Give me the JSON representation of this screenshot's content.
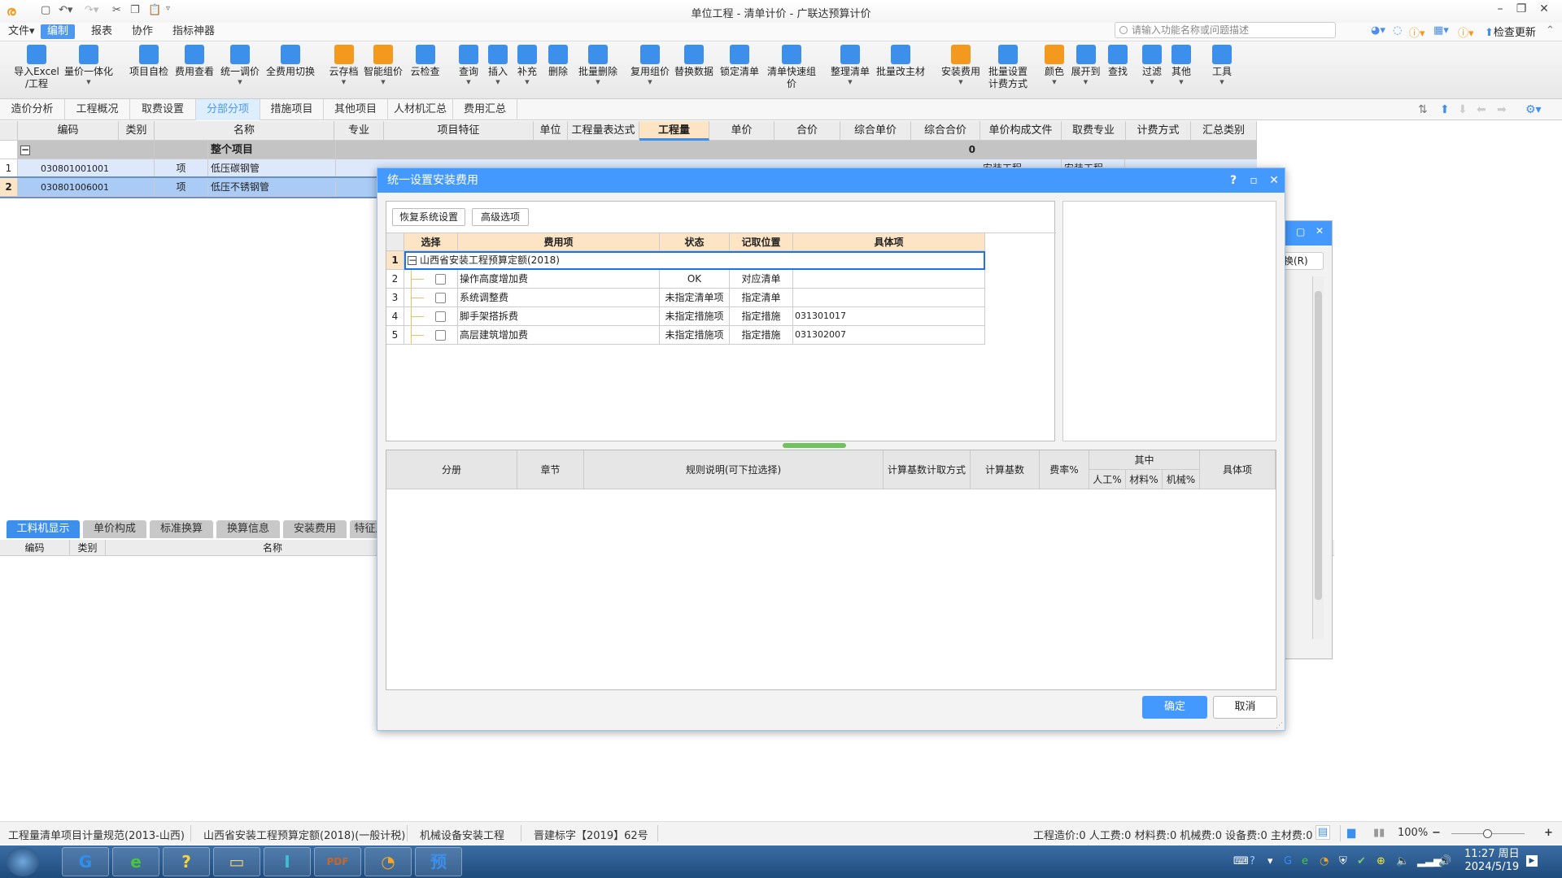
{
  "window": {
    "title": "单位工程 - 清单计价 - 广联达预算计价",
    "quick_access": [
      "save-icon",
      "undo-icon",
      "redo-icon",
      "cut-icon",
      "copy-icon",
      "paste-icon",
      "customize-icon"
    ]
  },
  "menu": {
    "items": [
      "文件▾",
      "编制",
      "报表",
      "协作",
      "指标神器"
    ],
    "active": "编制"
  },
  "search": {
    "placeholder": "请输入功能名称或问题描述"
  },
  "top_right": {
    "check_update": "检查更新"
  },
  "ribbon": {
    "buttons": [
      {
        "label": "导入Excel",
        "label2": "/工程",
        "icon": "import-excel-icon"
      },
      {
        "label": "量价一体化",
        "icon": "quantity-price-icon",
        "dropdown": true
      },
      {
        "label": "项目自检",
        "icon": "self-check-icon"
      },
      {
        "label": "费用查看",
        "icon": "fee-view-icon"
      },
      {
        "label": "统一调价",
        "icon": "adjust-price-icon",
        "dropdown": true
      },
      {
        "label": "全费用切换",
        "icon": "full-fee-switch-icon"
      },
      {
        "label": "云存档",
        "icon": "cloud-save-icon",
        "dropdown": true
      },
      {
        "label": "智能组价",
        "icon": "smart-pricing-icon",
        "dropdown": true
      },
      {
        "label": "云检查",
        "icon": "cloud-check-icon"
      },
      {
        "label": "查询",
        "icon": "query-icon",
        "dropdown": true
      },
      {
        "label": "插入",
        "icon": "insert-icon",
        "dropdown": true
      },
      {
        "label": "补充",
        "icon": "supplement-icon",
        "dropdown": true
      },
      {
        "label": "删除",
        "icon": "delete-icon"
      },
      {
        "label": "批量删除",
        "icon": "batch-delete-icon",
        "dropdown": true
      },
      {
        "label": "复用组价",
        "icon": "reuse-pricing-icon",
        "dropdown": true
      },
      {
        "label": "替换数据",
        "icon": "replace-data-icon"
      },
      {
        "label": "锁定清单",
        "icon": "lock-list-icon"
      },
      {
        "label": "清单快速组价",
        "icon": "quick-pricing-icon"
      },
      {
        "label": "整理清单",
        "icon": "organize-list-icon",
        "dropdown": true
      },
      {
        "label": "批量改主材",
        "icon": "batch-material-icon"
      },
      {
        "label": "安装费用",
        "icon": "install-fee-icon",
        "dropdown": true
      },
      {
        "label": "批量设置",
        "label2": "计费方式",
        "icon": "fee-setting-icon"
      },
      {
        "label": "颜色",
        "icon": "color-icon",
        "dropdown": true
      },
      {
        "label": "展开到",
        "icon": "expand-to-icon",
        "dropdown": true
      },
      {
        "label": "查找",
        "icon": "find-icon"
      },
      {
        "label": "过滤",
        "icon": "filter-icon",
        "dropdown": true
      },
      {
        "label": "其他",
        "icon": "other-icon",
        "dropdown": true
      },
      {
        "label": "工具",
        "icon": "tools-icon",
        "dropdown": true
      }
    ]
  },
  "tabs": {
    "items": [
      "造价分析",
      "工程概况",
      "取费设置",
      "分部分项",
      "措施项目",
      "其他项目",
      "人材机汇总",
      "费用汇总"
    ],
    "active": "分部分项"
  },
  "grid": {
    "headers": [
      "编码",
      "类别",
      "名称",
      "专业",
      "项目特征",
      "单位",
      "工程量表达式",
      "工程量",
      "单价",
      "合价",
      "综合单价",
      "综合合价",
      "单价构成文件",
      "取费专业",
      "计费方式",
      "汇总类别"
    ],
    "selected_header": "工程量",
    "root": {
      "toggle": "−",
      "name": "整个项目",
      "total": "0"
    },
    "rows": [
      {
        "num": "1",
        "code": "030801001001",
        "type": "项",
        "name": "低压碳钢管",
        "file": "安装工程",
        "fee_major": "安装工程"
      },
      {
        "num": "2",
        "code": "030801006001",
        "type": "项",
        "name": "低压不锈钢管"
      }
    ]
  },
  "lower_panel": {
    "tabs": [
      "工料机显示",
      "单价构成",
      "标准换算",
      "换算信息",
      "安装费用",
      "特征及"
    ],
    "active": "工料机显示",
    "headers": [
      "编码",
      "类别",
      "名称"
    ]
  },
  "back_dialog": {
    "button_label": "换(R)"
  },
  "dialog": {
    "title": "统一设置安装费用",
    "help": "?",
    "buttons": {
      "restore": "恢复系统设置",
      "advanced": "高级选项",
      "ok": "确定",
      "cancel": "取消"
    },
    "fee_table": {
      "headers": [
        "选择",
        "费用项",
        "状态",
        "记取位置",
        "具体项"
      ],
      "group": {
        "num": "1",
        "toggle": "−",
        "name": "山西省安装工程预算定额(2018)"
      },
      "rows": [
        {
          "num": "2",
          "checked": false,
          "item": "操作高度增加费",
          "status": "OK",
          "position": "对应清单",
          "detail": ""
        },
        {
          "num": "3",
          "checked": false,
          "item": "系统调整费",
          "status": "未指定清单项",
          "position": "指定清单",
          "detail": ""
        },
        {
          "num": "4",
          "checked": false,
          "item": "脚手架搭拆费",
          "status": "未指定措施项",
          "position": "指定措施",
          "detail": "031301017"
        },
        {
          "num": "5",
          "checked": false,
          "item": "高层建筑增加费",
          "status": "未指定措施项",
          "position": "指定措施",
          "detail": "031302007"
        }
      ]
    },
    "rule_table": {
      "headers": [
        "分册",
        "章节",
        "规则说明(可下拉选择)",
        "计算基数计取方式",
        "计算基数",
        "费率%",
        "其中",
        "具体项"
      ],
      "sub_headers": [
        "人工%",
        "材料%",
        "机械%"
      ]
    }
  },
  "status_bar": {
    "left": [
      "工程量清单项目计量规范(2013-山西)",
      "山西省安装工程预算定额(2018)(一般计税)",
      "机械设备安装工程",
      "晋建标字【2019】62号"
    ],
    "totals": "工程造价:0  人工费:0  材料费:0  机械费:0  设备费:0  主材费:0",
    "zoom": "100%",
    "zoom_value_percent": 100
  },
  "taskbar": {
    "apps": [
      {
        "name": "glodon-g-icon",
        "glyph": "G",
        "color": "#2f8ff0"
      },
      {
        "name": "ie-browser-icon",
        "glyph": "e",
        "color": "#4cc341"
      },
      {
        "name": "help-doc-icon",
        "glyph": "?",
        "color": "#f5d33a"
      },
      {
        "name": "folder-icon",
        "glyph": "▭",
        "color": "#f1d27a"
      },
      {
        "name": "i-app-icon",
        "glyph": "I",
        "color": "#3fc0d0"
      },
      {
        "name": "pdf-icon",
        "glyph": "PDF",
        "color": "#c5672d"
      },
      {
        "name": "glodon-cloud-icon",
        "glyph": "◔",
        "color": "#f5a623"
      },
      {
        "name": "yusuan-icon",
        "glyph": "预",
        "color": "#3d8fec"
      }
    ],
    "clock_time": "11:27 周日",
    "clock_date": "2024/5/19"
  }
}
